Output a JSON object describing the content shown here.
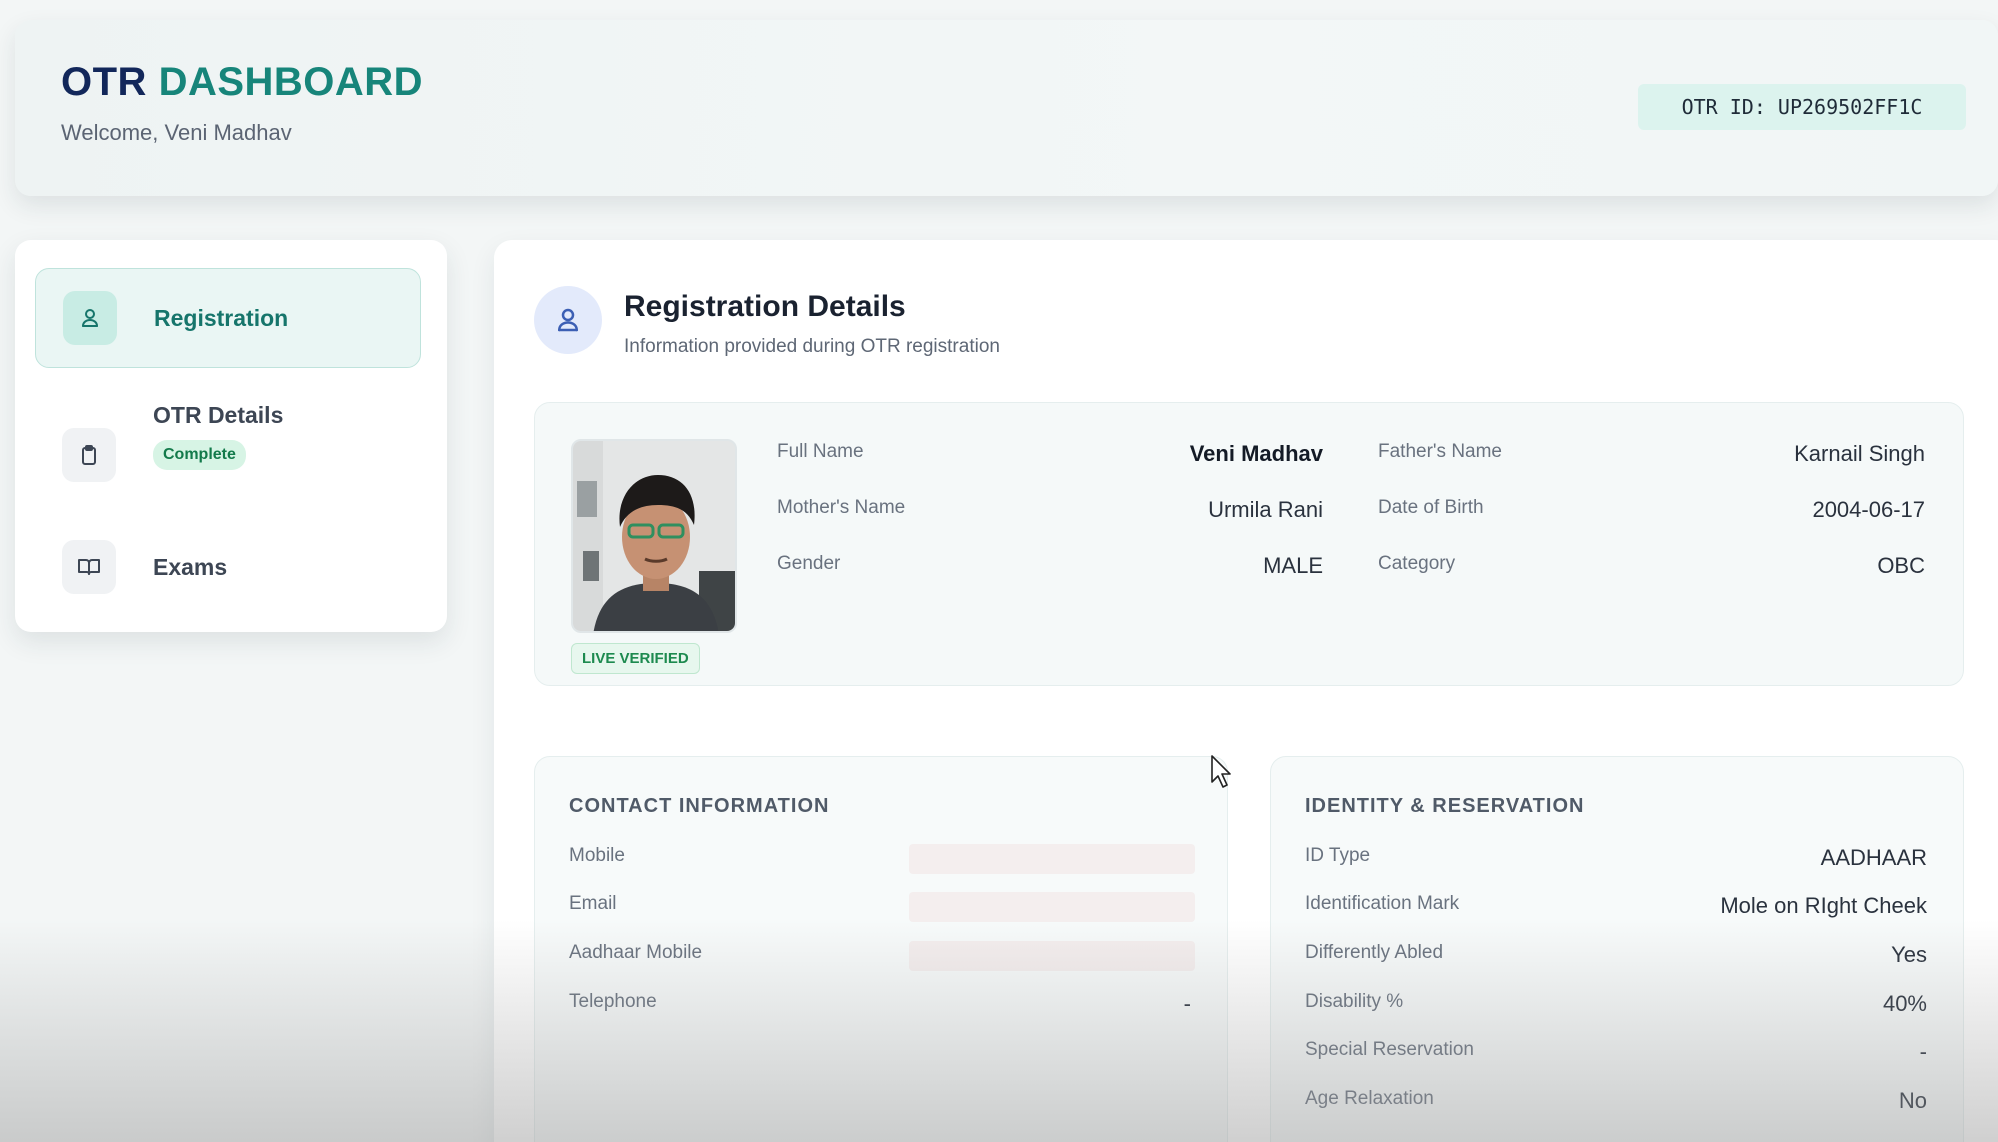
{
  "header": {
    "brand_prefix": "OTR",
    "brand_suffix": "DASHBOARD",
    "welcome": "Welcome, Veni Madhav",
    "otr_id": "OTR ID: UP269502FF1C"
  },
  "sidebar": {
    "items": [
      {
        "label": "Registration",
        "icon": "user-icon",
        "active": true
      },
      {
        "label": "OTR Details",
        "icon": "clipboard-icon",
        "badge": "Complete"
      },
      {
        "label": "Exams",
        "icon": "book-icon"
      }
    ]
  },
  "section": {
    "title": "Registration Details",
    "subtitle": "Information provided during OTR registration",
    "icon": "user-icon"
  },
  "profile": {
    "photo_badge": "LIVE VERIFIED",
    "fields": [
      {
        "label": "Full Name",
        "value": "Veni Madhav"
      },
      {
        "label": "Father's Name",
        "value": "Karnail Singh"
      },
      {
        "label": "Mother's Name",
        "value": "Urmila Rani"
      },
      {
        "label": "Date of Birth",
        "value": "2004-06-17"
      },
      {
        "label": "Gender",
        "value": "MALE"
      },
      {
        "label": "Category",
        "value": "OBC"
      }
    ]
  },
  "contact": {
    "title": "CONTACT INFORMATION",
    "rows": [
      {
        "label": "Mobile",
        "value": ""
      },
      {
        "label": "Email",
        "value": ""
      },
      {
        "label": "Aadhaar Mobile",
        "value": ""
      },
      {
        "label": "Telephone",
        "value": "-"
      }
    ]
  },
  "identity": {
    "title": "IDENTITY & RESERVATION",
    "rows": [
      {
        "label": "ID Type",
        "value": "AADHAAR"
      },
      {
        "label": "Identification Mark",
        "value": "Mole on RIght Cheek"
      },
      {
        "label": "Differently Abled",
        "value": "Yes"
      },
      {
        "label": "Disability %",
        "value": "40%"
      },
      {
        "label": "Special Reservation",
        "value": "-"
      },
      {
        "label": "Age Relaxation",
        "value": "No"
      }
    ]
  },
  "colors": {
    "brand_navy": "#12275a",
    "brand_teal": "#17857a",
    "active_bg": "#eaf6f4",
    "badge_green": "#137a4b"
  }
}
